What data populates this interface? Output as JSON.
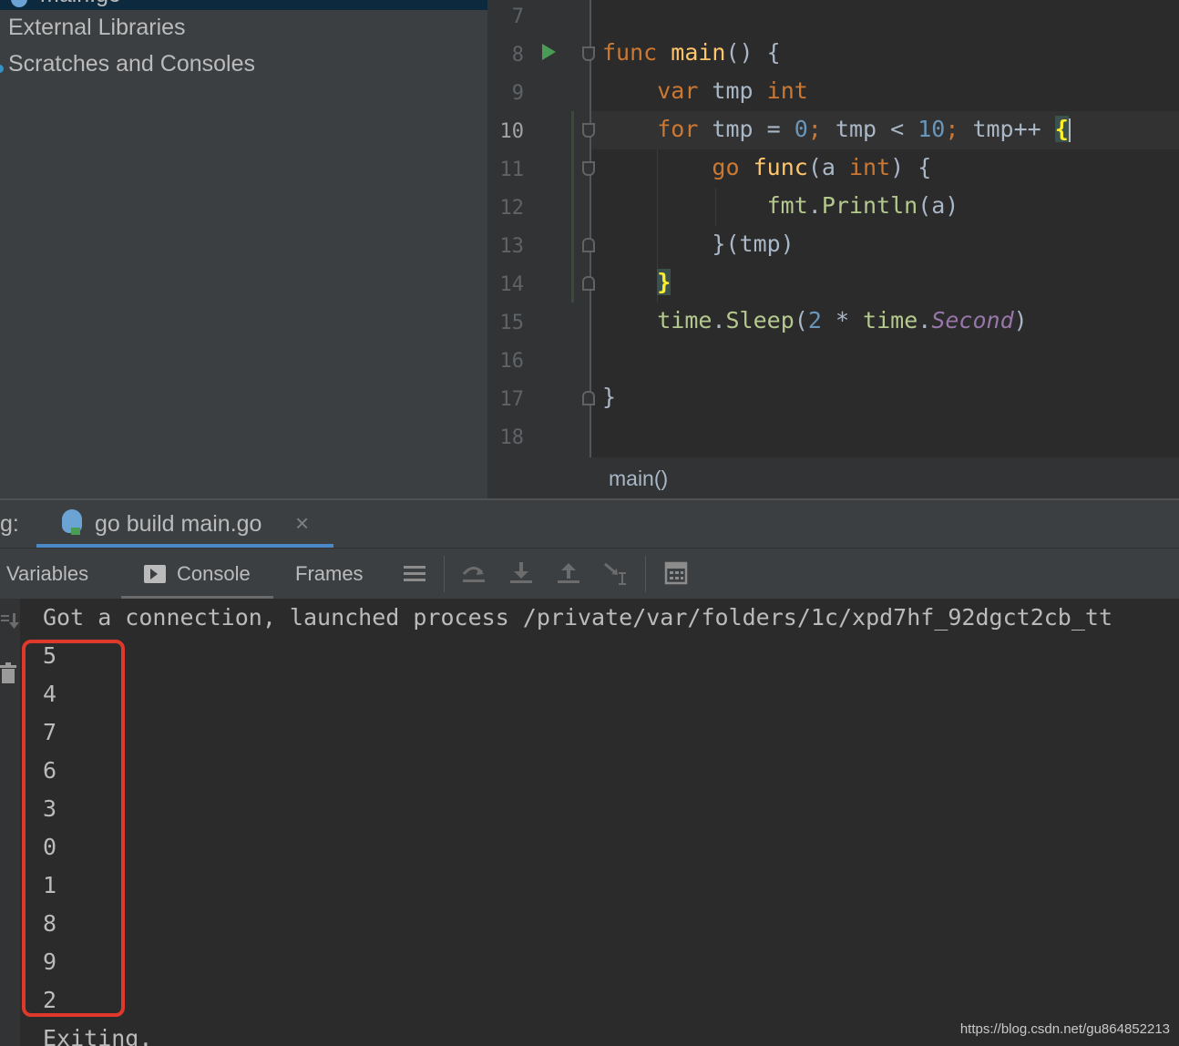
{
  "sidebar": {
    "selected_item": "main.go",
    "items": [
      "External Libraries",
      "Scratches and Consoles"
    ]
  },
  "editor": {
    "line_numbers": [
      "7",
      "8",
      "9",
      "10",
      "11",
      "12",
      "13",
      "14",
      "15",
      "16",
      "17",
      "18"
    ],
    "current_line": "10",
    "code": {
      "l8_kw": "func",
      "l8_fn": "main",
      "l8_rest": "() {",
      "l9_kw": "var",
      "l9_id": " tmp ",
      "l9_type": "int",
      "l10_kw": "for",
      "l10_a": " tmp = ",
      "l10_n0": "0",
      "l10_semi1": ";",
      "l10_b": " tmp < ",
      "l10_n10": "10",
      "l10_semi2": ";",
      "l10_c": " tmp++ ",
      "l10_brace": "{",
      "l11_kw": "go",
      "l11_fn": "func",
      "l11_a": "(a ",
      "l11_type": "int",
      "l11_b": ") {",
      "l12_pkg": "fmt",
      "l12_dot": ".",
      "l12_m": "Println",
      "l12_rest": "(a)",
      "l13": "}(tmp)",
      "l14_brace": "}",
      "l15_pkg": "time",
      "l15_dot": ".",
      "l15_m": "Sleep",
      "l15_a": "(",
      "l15_n": "2",
      "l15_b": " * ",
      "l15_pkg2": "time",
      "l15_dot2": ".",
      "l15_const": "Second",
      "l15_c": ")",
      "l17": "}"
    },
    "breadcrumb": "main()"
  },
  "debug": {
    "window_label": "g:",
    "session_tab": "go build main.go",
    "tabs": {
      "variables": "Variables",
      "console": "Console",
      "frames": "Frames"
    },
    "icons": [
      "list-icon",
      "step-over-icon",
      "step-into-icon",
      "step-out-icon",
      "run-to-cursor-icon",
      "evaluate-icon"
    ]
  },
  "console": {
    "first_line": "Got a connection, launched process /private/var/folders/1c/xpd7hf_92dgct2cb_tt",
    "outputs": [
      "5",
      "4",
      "7",
      "6",
      "3",
      "0",
      "1",
      "8",
      "9",
      "2"
    ],
    "last_line": "Exiting."
  },
  "watermark": "https://blog.csdn.net/gu864852213",
  "colors": {
    "keyword": "#cc7832",
    "function": "#ffc66d",
    "number": "#6897bb",
    "constant": "#9876aa",
    "highlight_box": "#e0392b"
  }
}
